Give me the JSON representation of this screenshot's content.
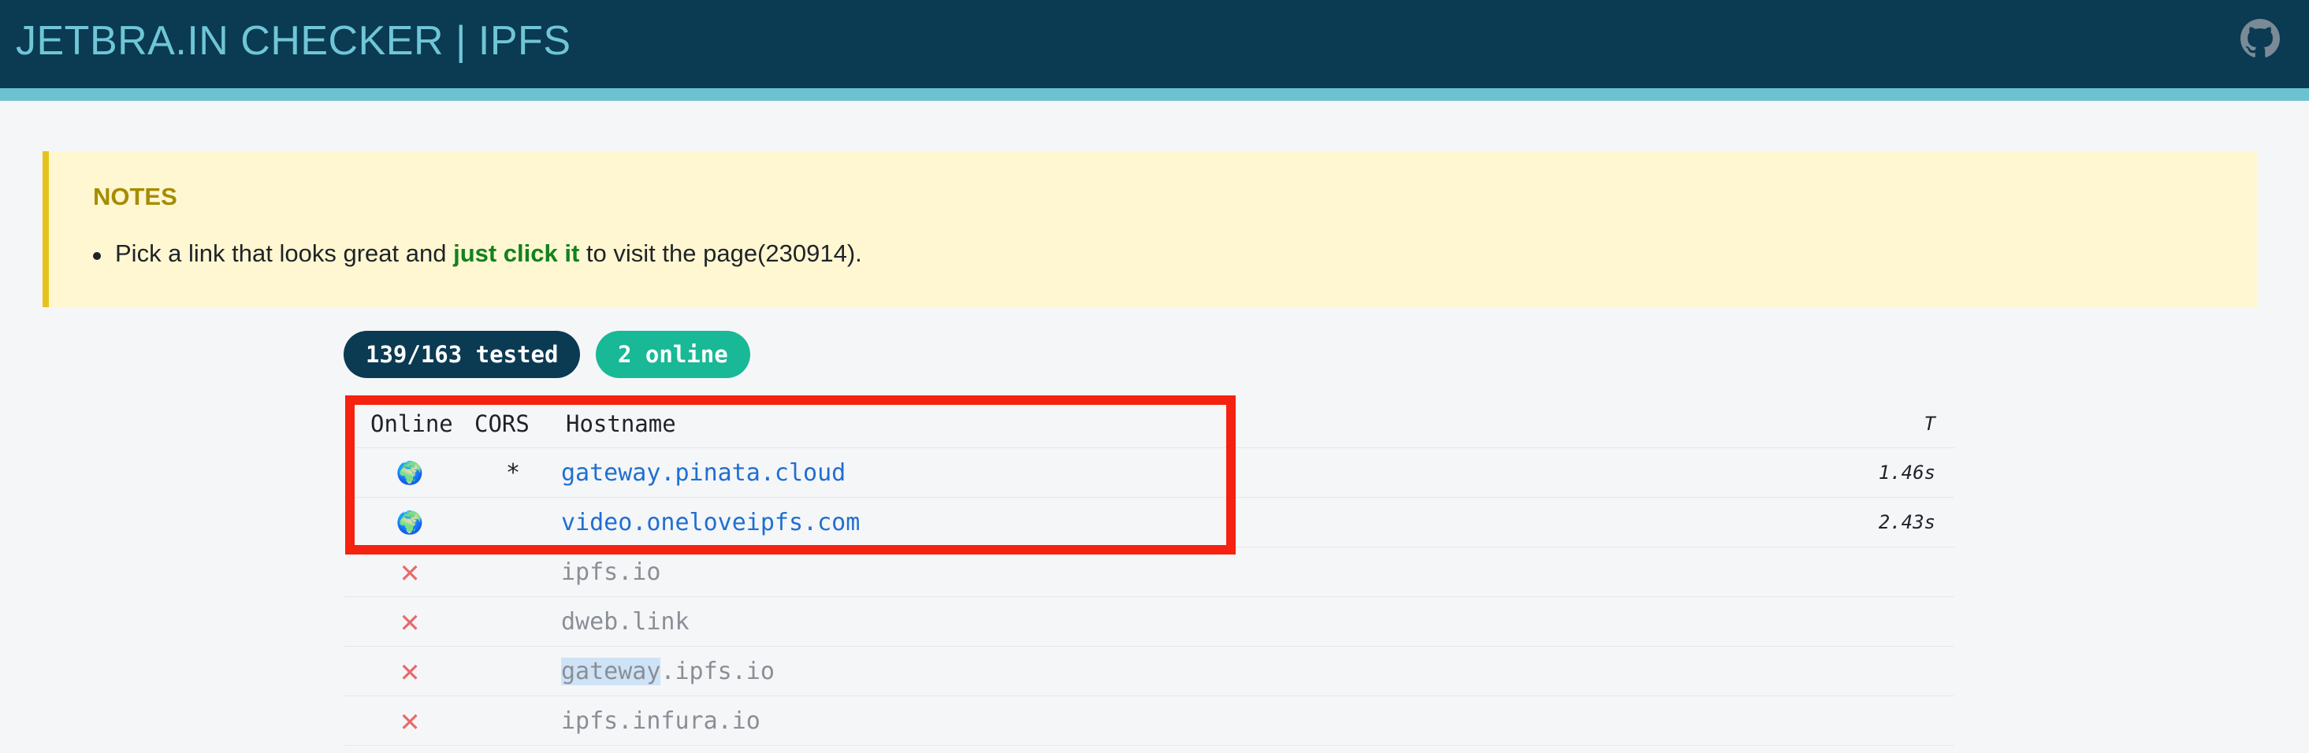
{
  "header": {
    "title": "JETBRA.IN CHECKER | IPFS",
    "github_icon": "github-icon",
    "background": "#0b3a53",
    "accent": "#6cc2d0"
  },
  "notes": {
    "title": "NOTES",
    "item_prefix": "Pick a link that looks great and ",
    "item_emphasis": "just click it",
    "item_suffix": " to visit the page(230914)."
  },
  "badges": {
    "tested": "139/163 tested",
    "online": "2 online"
  },
  "table": {
    "columns": {
      "online": "Online",
      "cors": "CORS",
      "hostname": "Hostname",
      "time": "T"
    },
    "rows": [
      {
        "status": "online",
        "status_icon": "globe-icon",
        "status_glyph": "🌍",
        "cors": "*",
        "hostname": "gateway.pinata.cloud",
        "time": "1.46s"
      },
      {
        "status": "online",
        "status_icon": "globe-icon",
        "status_glyph": "🌍",
        "cors": "",
        "hostname": "video.oneloveipfs.com",
        "time": "2.43s"
      },
      {
        "status": "offline",
        "status_icon": "cross-icon",
        "status_glyph": "✕",
        "cors": "",
        "hostname": "ipfs.io",
        "time": ""
      },
      {
        "status": "offline",
        "status_icon": "cross-icon",
        "status_glyph": "✕",
        "cors": "",
        "hostname": "dweb.link",
        "time": ""
      },
      {
        "status": "offline",
        "status_icon": "cross-icon",
        "status_glyph": "✕",
        "cors": "",
        "hostname_selected": "gateway",
        "hostname_rest": ".ipfs.io",
        "time": ""
      },
      {
        "status": "offline",
        "status_icon": "cross-icon",
        "status_glyph": "✕",
        "cors": "",
        "hostname": "ipfs.infura.io",
        "time": ""
      }
    ]
  },
  "colors": {
    "link": "#1f6fd1",
    "success": "#19b896",
    "failure": "#e86a6a",
    "annotation": "#f5220f",
    "notes_bg": "#fff7d1"
  }
}
